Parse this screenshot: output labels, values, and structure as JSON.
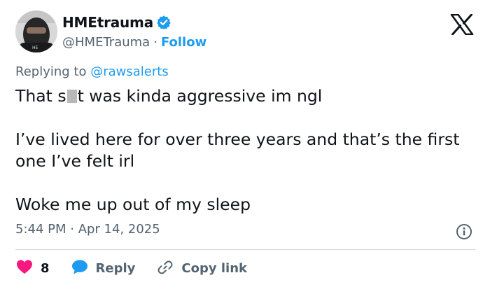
{
  "author": {
    "display_name": "HMEtrauma",
    "handle": "@HMETrauma",
    "separator": "·",
    "follow_label": "Follow"
  },
  "reply_context": {
    "prefix": "Replying to",
    "mention": "@rawsalerts"
  },
  "tweet": {
    "line1_before": "That s",
    "line1_after": "t was kinda aggressive im ngl",
    "paragraph2": "I’ve lived here for over three years and that’s the first one I’ve felt irl",
    "paragraph3": "Woke me up out of my sleep"
  },
  "timestamp": "5:44 PM · Apr 14, 2025",
  "actions": {
    "like_count": "8",
    "reply_label": "Reply",
    "copy_link_label": "Copy link"
  },
  "colors": {
    "accent": "#1d9bf0",
    "like": "#f91880",
    "secondary_text": "#536471",
    "divider": "#cfd9de"
  },
  "icons": [
    "verified-badge-icon",
    "x-logo-icon",
    "info-icon",
    "heart-icon",
    "reply-bubble-icon",
    "link-icon"
  ]
}
